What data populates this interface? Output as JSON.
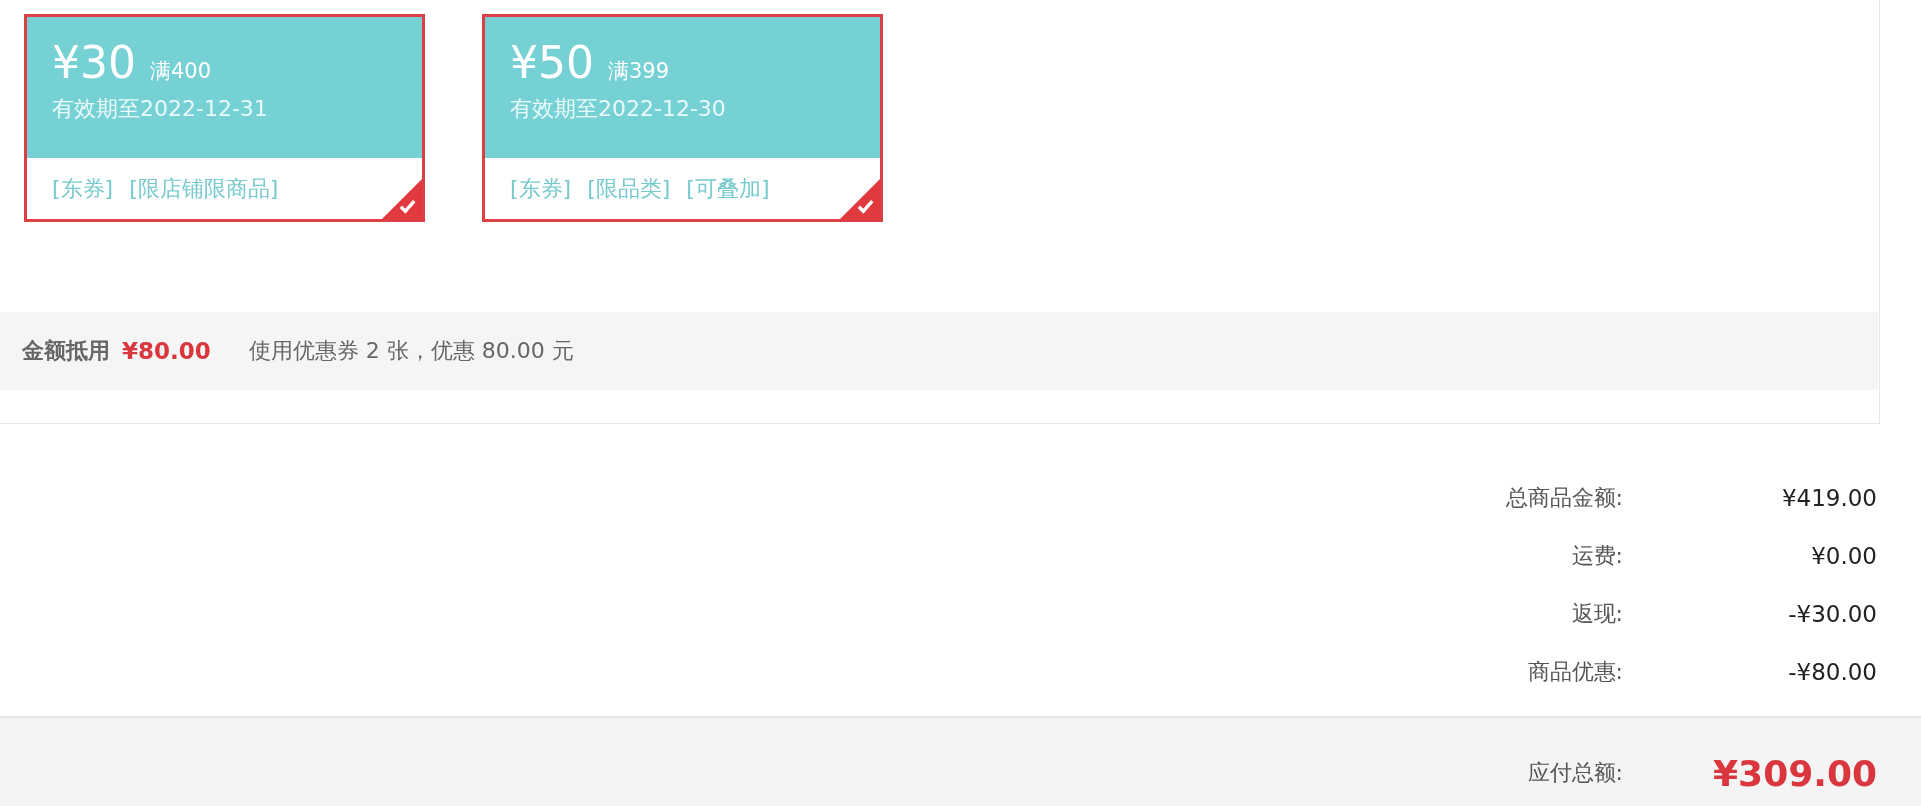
{
  "coupons": [
    {
      "amount": "¥30",
      "threshold": "满400",
      "validity": "有效期至2022-12-31",
      "tags": [
        "[东券]",
        "[限店铺限商品]"
      ],
      "selected": true
    },
    {
      "amount": "¥50",
      "threshold": "满399",
      "validity": "有效期至2022-12-30",
      "tags": [
        "[东券]",
        "[限品类]",
        "[可叠加]"
      ],
      "selected": true
    }
  ],
  "deduction": {
    "label": "金额抵用",
    "amount": "¥80.00",
    "note": "使用优惠券 2 张，优惠 80.00 元"
  },
  "totals": [
    {
      "label": "总商品金额:",
      "value": "¥419.00"
    },
    {
      "label": "运费:",
      "value": "¥0.00"
    },
    {
      "label": "返现:",
      "value": "-¥30.00"
    },
    {
      "label": "商品优惠:",
      "value": "-¥80.00"
    }
  ],
  "payable": {
    "label": "应付总额:",
    "value": "¥309.00"
  }
}
